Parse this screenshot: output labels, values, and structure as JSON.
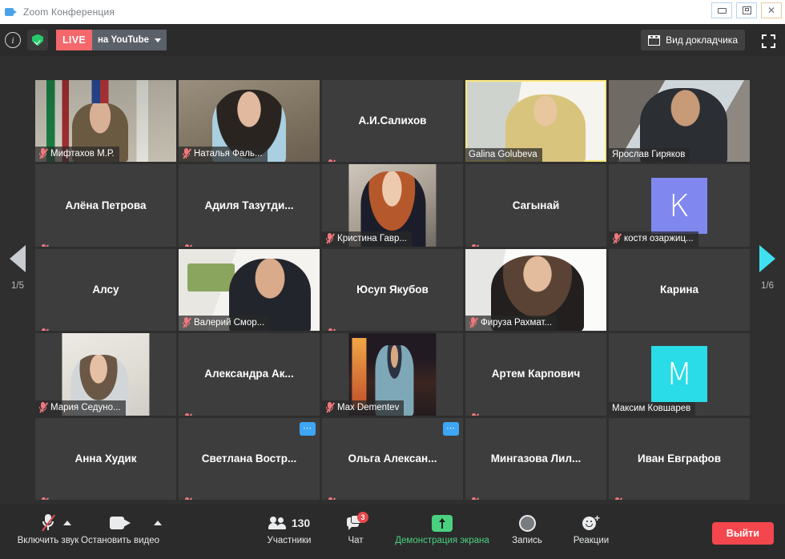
{
  "window": {
    "title": "Zoom Конференция",
    "icon": "zoom-logo-icon",
    "minimize_label": "",
    "maximize_label": "",
    "close_label": "✕"
  },
  "header": {
    "info_icon_label": "i",
    "shield_icon": "shield-check-icon",
    "live_badge": "LIVE",
    "live_destination": "на YouTube",
    "speaker_view_label": "Вид докладчика",
    "fullscreen_icon": "fullscreen-icon"
  },
  "pager": {
    "left_label": "1/5",
    "right_label": "1/6",
    "left_icon": "chevron-left-icon",
    "right_icon": "chevron-right-icon",
    "right_color": "#3fe0ef"
  },
  "gallery": {
    "rows": 5,
    "cols": 5,
    "tiles": [
      {
        "name": "Мифтахов М.Р.",
        "video": "v-mift",
        "video_fit": "full",
        "muted": true,
        "active": false,
        "namebar": true
      },
      {
        "name": "Наталья Фаль...",
        "video": "v-nat",
        "video_fit": "full",
        "muted": true,
        "active": false,
        "namebar": true
      },
      {
        "name": "А.И.Салихов",
        "video": null,
        "video_fit": null,
        "muted": true,
        "active": false,
        "namebar": false
      },
      {
        "name": "Galina Golubeva",
        "video": "v-gal",
        "video_fit": "full",
        "muted": false,
        "active": true,
        "namebar": true
      },
      {
        "name": "Ярослав Гиряков",
        "video": "v-yar",
        "video_fit": "full",
        "muted": false,
        "active": false,
        "namebar": true
      },
      {
        "name": "Алёна Петрова",
        "video": null,
        "video_fit": null,
        "muted": true,
        "active": false,
        "namebar": false
      },
      {
        "name": "Адиля  Тазутди...",
        "video": null,
        "video_fit": null,
        "muted": true,
        "active": false,
        "namebar": false
      },
      {
        "name": "Кристина Гавр...",
        "video": "v-kris",
        "video_fit": "portrait",
        "muted": true,
        "active": false,
        "namebar": true
      },
      {
        "name": "Сагынай",
        "video": null,
        "video_fit": null,
        "muted": true,
        "active": false,
        "namebar": false
      },
      {
        "name": "костя озаржиц...",
        "video": null,
        "video_fit": null,
        "muted": true,
        "active": false,
        "namebar": true,
        "avatar_letter": "К",
        "avatar_color": "#8088ef"
      },
      {
        "name": "Алсу",
        "video": null,
        "video_fit": null,
        "muted": true,
        "active": false,
        "namebar": false
      },
      {
        "name": "Валерий Смор...",
        "video": "v-val",
        "video_fit": "full",
        "muted": true,
        "active": false,
        "namebar": true
      },
      {
        "name": "Юсуп Якубов",
        "video": null,
        "video_fit": null,
        "muted": true,
        "active": false,
        "namebar": false
      },
      {
        "name": "Фируза Рахмат...",
        "video": "v-fir",
        "video_fit": "full",
        "muted": true,
        "active": false,
        "namebar": true
      },
      {
        "name": "Карина",
        "video": null,
        "video_fit": null,
        "muted": false,
        "active": false,
        "namebar": false
      },
      {
        "name": "Мария Седуно...",
        "video": "v-mar",
        "video_fit": "portrait",
        "muted": true,
        "active": false,
        "namebar": true
      },
      {
        "name": "Александра  Ак...",
        "video": null,
        "video_fit": null,
        "muted": true,
        "active": false,
        "namebar": false
      },
      {
        "name": "Max Dementev",
        "video": "v-max",
        "video_fit": "portrait",
        "muted": true,
        "active": false,
        "namebar": true
      },
      {
        "name": "Артем Карпович",
        "video": null,
        "video_fit": null,
        "muted": true,
        "active": false,
        "namebar": false
      },
      {
        "name": "Максим Ковшарев",
        "video": null,
        "video_fit": null,
        "muted": false,
        "active": false,
        "namebar": true,
        "avatar_letter": "M",
        "avatar_color": "#2adbe8"
      },
      {
        "name": "Анна Худик",
        "video": null,
        "video_fit": null,
        "muted": true,
        "active": false,
        "namebar": false
      },
      {
        "name": "Светлана  Востр...",
        "video": null,
        "video_fit": null,
        "muted": true,
        "active": false,
        "namebar": false,
        "more": true
      },
      {
        "name": "Ольга  Алексан...",
        "video": null,
        "video_fit": null,
        "muted": true,
        "active": false,
        "namebar": false,
        "more": true
      },
      {
        "name": "Мингазова  Лил...",
        "video": null,
        "video_fit": null,
        "muted": true,
        "active": false,
        "namebar": false
      },
      {
        "name": "Иван Евграфов",
        "video": null,
        "video_fit": null,
        "muted": true,
        "active": false,
        "namebar": false
      }
    ]
  },
  "toolbar": {
    "mute": {
      "label": "Включить звук",
      "icon": "microphone-muted-icon"
    },
    "video": {
      "label": "Остановить видео",
      "icon": "camera-icon"
    },
    "participants": {
      "label": "Участники",
      "count": "130",
      "icon": "people-icon"
    },
    "chat": {
      "label": "Чат",
      "badge": "3",
      "icon": "chat-bubble-icon"
    },
    "share": {
      "label": "Демонстрация экрана",
      "icon": "share-screen-icon",
      "color": "#4ad17f"
    },
    "record": {
      "label": "Запись",
      "icon": "record-icon"
    },
    "reactions": {
      "label": "Реакции",
      "icon": "reactions-smiley-icon"
    },
    "leave": {
      "label": "Выйти",
      "color": "#f4474d"
    }
  }
}
